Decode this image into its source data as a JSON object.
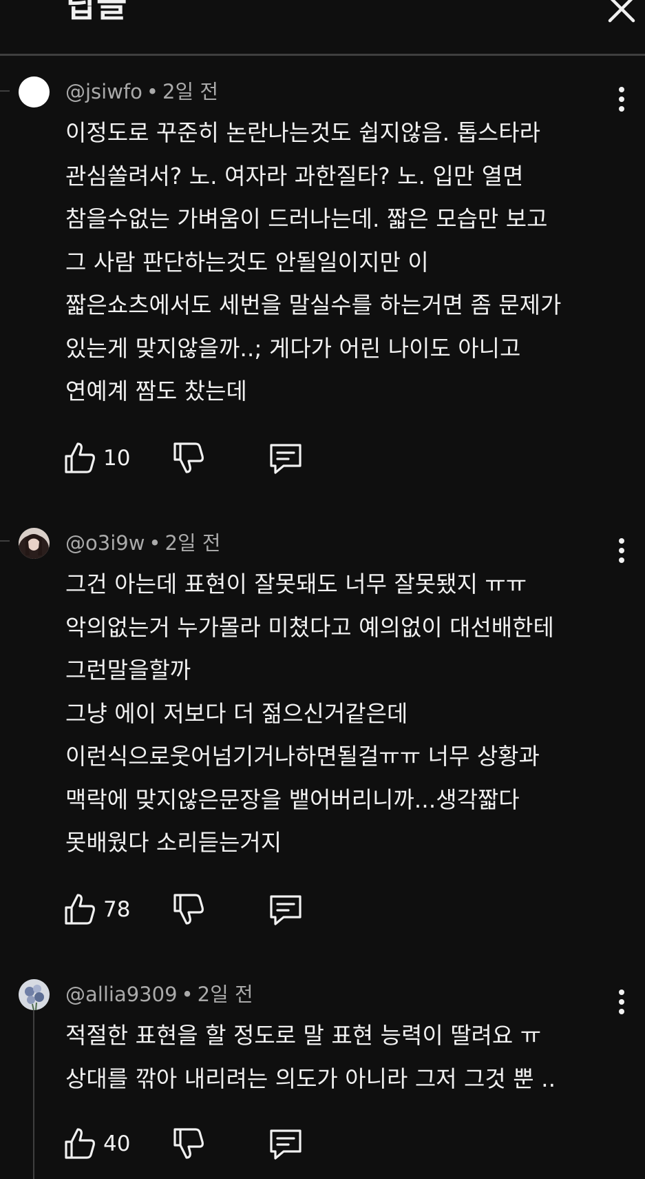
{
  "header": {
    "title": "답글"
  },
  "comments": [
    {
      "username": "@jsiwfo",
      "time": "2일 전",
      "lines": [
        "이정도로 꾸준히 논란나는것도 쉽지않음. 톱스타라",
        "관심쏠려서? 노. 여자라 과한질타? 노. 입만 열면",
        "참을수없는 가벼움이 드러나는데. 짧은 모습만 보고",
        "그 사람 판단하는것도 안될일이지만 이",
        "짧은쇼츠에서도 세번을 말실수를 하는거면 좀 문제가",
        "있는게 맞지않을까..; 게다가 어린 나이도 아니고",
        "연예계 짬도 찼는데"
      ],
      "likes": "10",
      "avatar_color": "#ffffff"
    },
    {
      "username": "@o3i9w",
      "time": "2일 전",
      "lines": [
        "그건 아는데 표현이 잘못돼도 너무 잘못됐지 ㅠㅠ",
        "악의없는거 누가몰라 미쳤다고 예의없이 대선배한테",
        "그런말을할까",
        "그냥 에이 저보다 더 젊으신거같은데",
        "이런식으로웃어넘기거나하면될걸ㅠㅠ 너무 상황과",
        "맥락에 맞지않은문장을 뱉어버리니까...생각짧다",
        "못배웠다 소리듣는거지"
      ],
      "likes": "78",
      "avatar_color": "#5a4a48"
    },
    {
      "username": "@allia9309",
      "time": "2일 전",
      "lines": [
        "적절한 표현을 할 정도로 말 표현 능력이 딸려요 ㅠ",
        "상대를 깎아 내리려는 의도가 아니라 그저 그것 뿐 .."
      ],
      "likes": "40",
      "avatar_color": "#c8cdd6"
    }
  ],
  "icons": {
    "close": "close-icon",
    "more": "more-vert-icon",
    "like": "thumb-up-icon",
    "dislike": "thumb-down-icon",
    "reply": "reply-comment-icon"
  }
}
